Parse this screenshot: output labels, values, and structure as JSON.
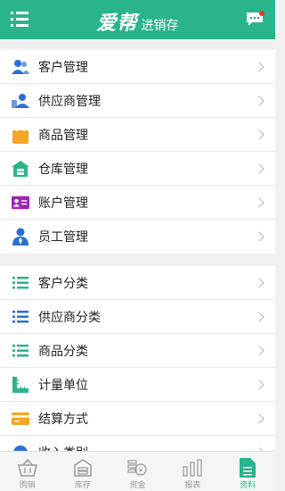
{
  "header": {
    "brand": "爱帮",
    "subtitle": "进销存"
  },
  "section1": [
    {
      "label": "客户管理",
      "icon": "customer-icon"
    },
    {
      "label": "供应商管理",
      "icon": "supplier-icon"
    },
    {
      "label": "商品管理",
      "icon": "goods-bag-icon"
    },
    {
      "label": "仓库管理",
      "icon": "warehouse-icon"
    },
    {
      "label": "账户管理",
      "icon": "account-card-icon"
    },
    {
      "label": "员工管理",
      "icon": "employee-icon"
    }
  ],
  "section2": [
    {
      "label": "客户分类",
      "icon": "list-icon"
    },
    {
      "label": "供应商分类",
      "icon": "list-icon"
    },
    {
      "label": "商品分类",
      "icon": "list-icon"
    },
    {
      "label": "计量单位",
      "icon": "ruler-icon"
    },
    {
      "label": "结算方式",
      "icon": "payment-card-icon"
    },
    {
      "label": "收入类别",
      "icon": "income-icon"
    }
  ],
  "tabs": [
    {
      "label": "购销",
      "icon": "basket-icon"
    },
    {
      "label": "库存",
      "icon": "storage-icon"
    },
    {
      "label": "资金",
      "icon": "coins-icon"
    },
    {
      "label": "报表",
      "icon": "bar-chart-icon"
    },
    {
      "label": "资料",
      "icon": "document-icon",
      "active": true
    }
  ],
  "colors": {
    "accent": "#2ab48c",
    "blue": "#2a6fd6",
    "orange": "#f5a623",
    "purple": "#9b27b0"
  }
}
